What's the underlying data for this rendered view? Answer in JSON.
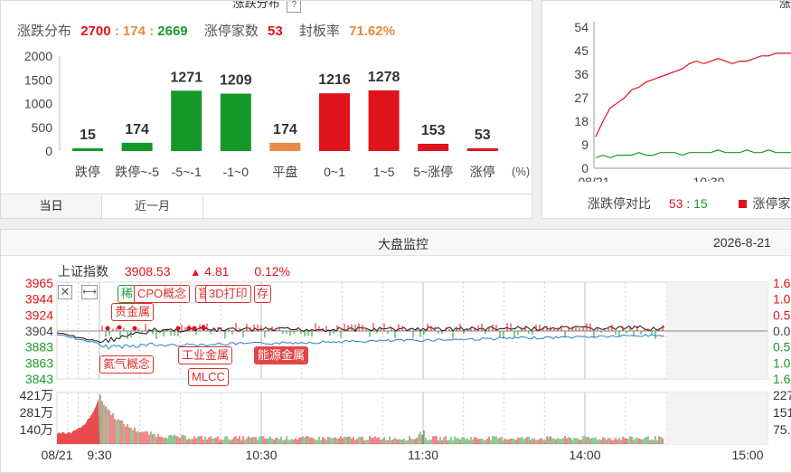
{
  "top_left": {
    "title": "涨跌分布",
    "help_icon": "?",
    "dist_label": "涨跌分布",
    "up_count": "2700",
    "flat_count": "174",
    "down_count": "2669",
    "sep": ":",
    "limit_label": "涨停家数",
    "limit_count": "53",
    "seal_label": "封板率",
    "seal_rate": "71.62%",
    "unit": "(%)",
    "tabs": [
      "当日",
      "近一月"
    ]
  },
  "chart_data": {
    "type": "bar",
    "categories": [
      "跌停",
      "跌停~-5",
      "-5~-1",
      "-1~0",
      "平盘",
      "0~1",
      "1~5",
      "5~涨停",
      "涨停"
    ],
    "values": [
      15,
      174,
      1271,
      1209,
      174,
      1216,
      1278,
      153,
      53
    ],
    "colors": [
      "#14982a",
      "#14982a",
      "#14982a",
      "#14982a",
      "#e88a48",
      "#e0121c",
      "#e0121c",
      "#e0121c",
      "#e0121c"
    ],
    "ylim": [
      0,
      2000
    ],
    "yticks": [
      0,
      500,
      1000,
      1500,
      2000
    ]
  },
  "top_right": {
    "title": "涨",
    "yticks": [
      "54",
      "45",
      "36",
      "27",
      "18",
      "9",
      "0"
    ],
    "xticks": [
      "08/21",
      "10:30"
    ],
    "ratio_label": "涨跌停对比",
    "ratio_up": "53",
    "ratio_sep": ":",
    "ratio_down": "15",
    "legend": "涨停家"
  },
  "monitor": {
    "title": "大盘监控",
    "date": "2026-8-21",
    "index_name": "上证指数",
    "index_value": "3908.53",
    "change_arrow": "▲",
    "change": "4.81",
    "change_pct": "0.12%",
    "yticks_left": [
      "3965",
      "3944",
      "3924",
      "3904",
      "3883",
      "3863",
      "3843"
    ],
    "yticks_right": [
      "1.6",
      "1.0",
      "0.5",
      "0.0",
      "0.5",
      "1.0",
      "1.6"
    ],
    "vol_ticks_left": [
      "421万",
      "281万",
      "140万"
    ],
    "vol_ticks_right": [
      "227",
      "151",
      "75."
    ],
    "xticks": [
      "08/21",
      "9:30",
      "10:30",
      "11:30",
      "14:00",
      "15:00"
    ],
    "tags": [
      "稀",
      "CPO概念",
      "盲",
      "3D打印",
      "存",
      "贵金属",
      "氦气概念",
      "工业金属",
      "能源金属",
      "MLCC"
    ]
  },
  "colors": {
    "up": "#e0121c",
    "down": "#1a9a28",
    "flat": "#e88a48",
    "seal": "#e38a3c"
  }
}
